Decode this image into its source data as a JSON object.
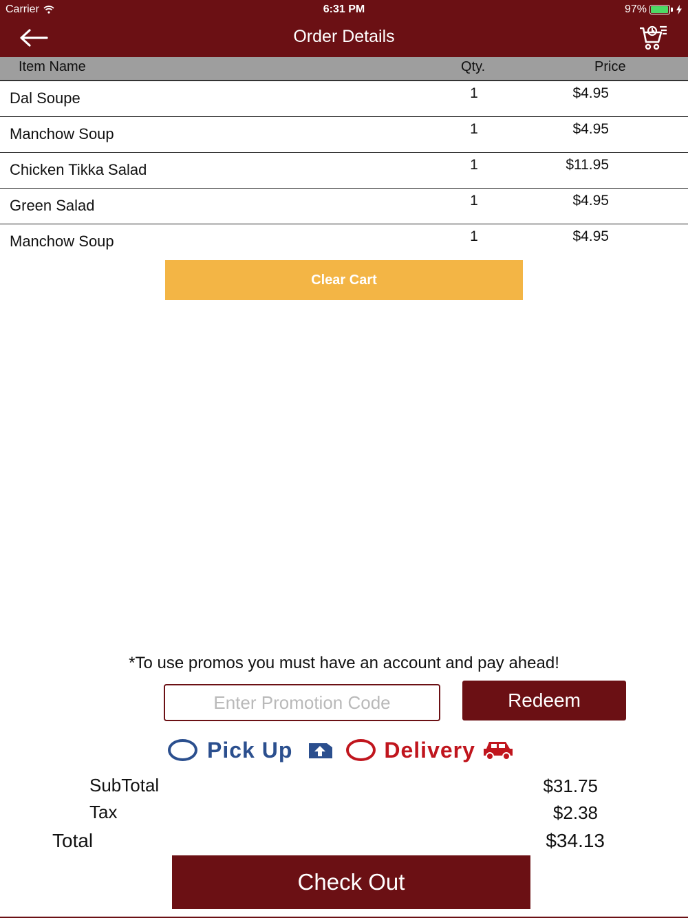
{
  "status_bar": {
    "carrier": "Carrier",
    "time": "6:31 PM",
    "battery": "97%"
  },
  "header": {
    "title": "Order Details",
    "back_icon": "arrow-left-icon",
    "cart_icon": "cart-icon"
  },
  "table": {
    "columns": [
      "Item Name",
      "Qty.",
      "Price"
    ],
    "rows": [
      {
        "name": "Dal Soupe",
        "qty": "1",
        "price": "$4.95"
      },
      {
        "name": "Manchow Soup",
        "qty": "1",
        "price": "$4.95"
      },
      {
        "name": "Chicken Tikka Salad",
        "qty": "1",
        "price": "$11.95"
      },
      {
        "name": "Green Salad",
        "qty": "1",
        "price": "$4.95"
      },
      {
        "name": "Manchow Soup",
        "qty": "1",
        "price": "$4.95"
      }
    ]
  },
  "clear_cart_label": "Clear Cart",
  "promo": {
    "note": "*To use promos you must have an account and pay ahead!",
    "placeholder": "Enter Promotion Code",
    "redeem_label": "Redeem"
  },
  "order_type": {
    "pickup_label": "Pick Up",
    "delivery_label": "Delivery"
  },
  "summary": {
    "subtotal_label": "SubTotal",
    "subtotal": "$31.75",
    "tax_label": "Tax",
    "tax": "$2.38",
    "total_label": "Total",
    "total": "$34.13"
  },
  "checkout_label": "Check Out",
  "colors": {
    "brand": "#6b1014",
    "accent": "#f3b545",
    "pickup": "#2b4f8e",
    "delivery": "#c0151d"
  }
}
